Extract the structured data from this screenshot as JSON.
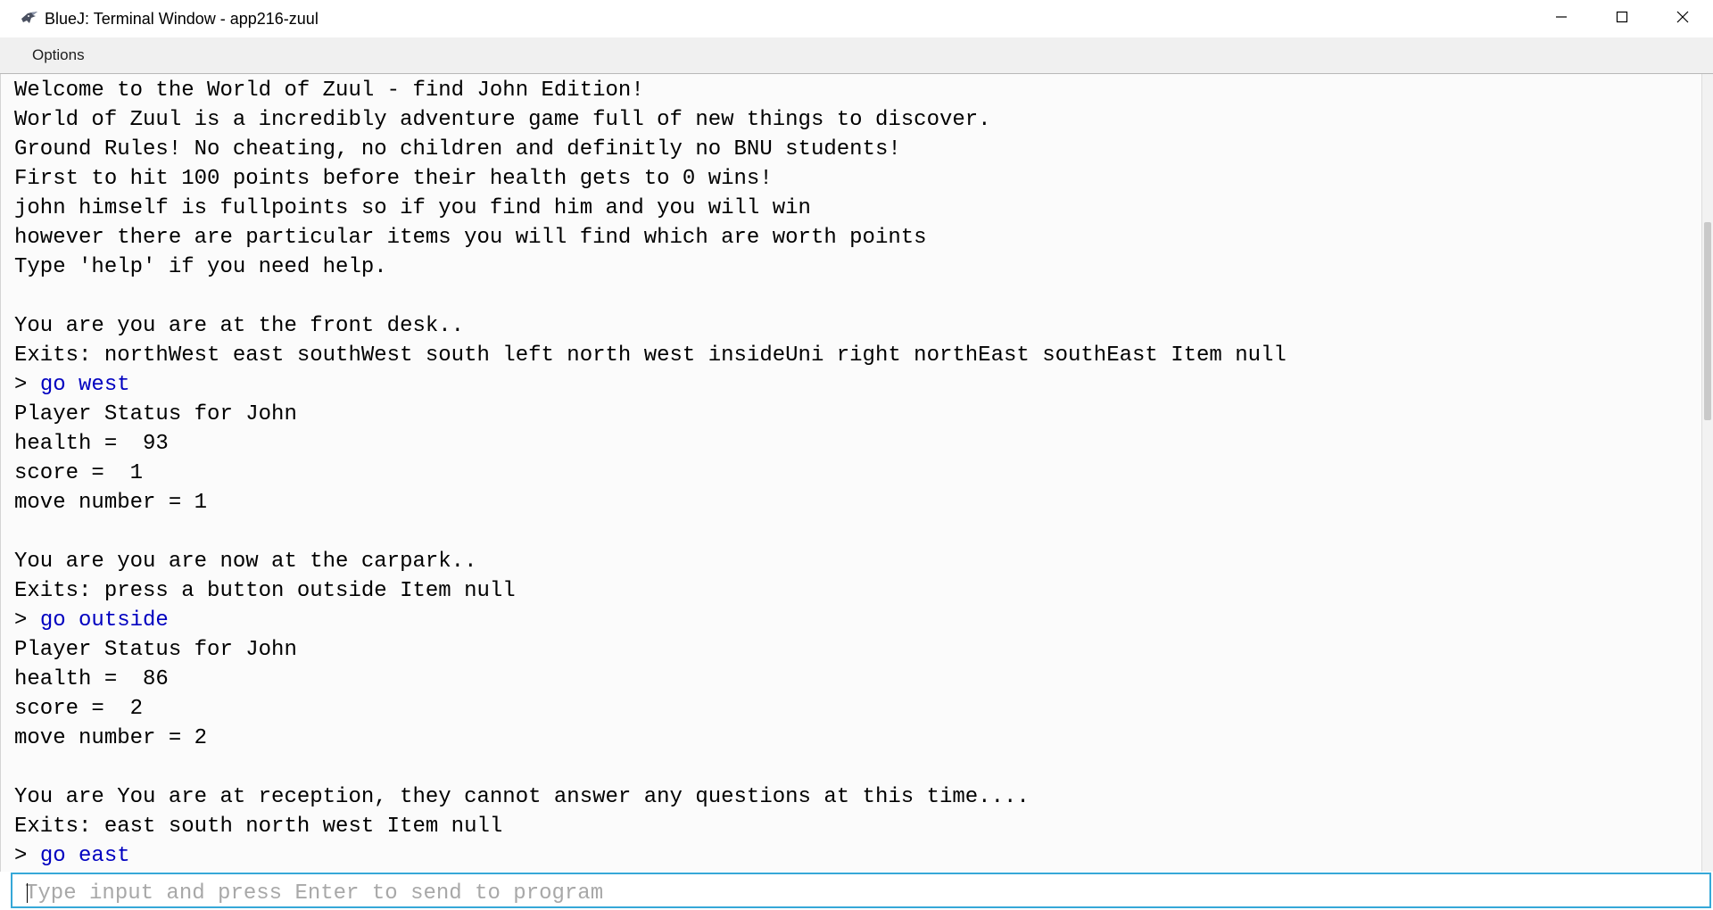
{
  "window": {
    "title": "BlueJ: Terminal Window - app216-zuul",
    "app_icon": "bluej-bird-icon",
    "controls": [
      "minimize-icon",
      "maximize-icon",
      "close-icon"
    ]
  },
  "menubar": {
    "items": [
      {
        "label": "Options"
      }
    ]
  },
  "terminal": {
    "lines": [
      {
        "type": "out",
        "text": "Welcome to the World of Zuul - find John Edition!"
      },
      {
        "type": "out",
        "text": "World of Zuul is a incredibly adventure game full of new things to discover."
      },
      {
        "type": "out",
        "text": "Ground Rules! No cheating, no children and definitly no BNU students!"
      },
      {
        "type": "out",
        "text": "First to hit 100 points before their health gets to 0 wins!"
      },
      {
        "type": "out",
        "text": "john himself is fullpoints so if you find him and you will win"
      },
      {
        "type": "out",
        "text": "however there are particular items you will find which are worth points"
      },
      {
        "type": "out",
        "text": "Type 'help' if you need help."
      },
      {
        "type": "out",
        "text": ""
      },
      {
        "type": "out",
        "text": "You are you are at the front desk.."
      },
      {
        "type": "out",
        "text": "Exits: northWest east southWest south left north west insideUni right northEast southEast Item null"
      },
      {
        "type": "cmd",
        "prompt": "> ",
        "text": "go west"
      },
      {
        "type": "out",
        "text": "Player Status for John"
      },
      {
        "type": "out",
        "text": "health =  93"
      },
      {
        "type": "out",
        "text": "score =  1"
      },
      {
        "type": "out",
        "text": "move number = 1"
      },
      {
        "type": "out",
        "text": ""
      },
      {
        "type": "out",
        "text": "You are you are now at the carpark.."
      },
      {
        "type": "out",
        "text": "Exits: press a button outside Item null"
      },
      {
        "type": "cmd",
        "prompt": "> ",
        "text": "go outside"
      },
      {
        "type": "out",
        "text": "Player Status for John"
      },
      {
        "type": "out",
        "text": "health =  86"
      },
      {
        "type": "out",
        "text": "score =  2"
      },
      {
        "type": "out",
        "text": "move number = 2"
      },
      {
        "type": "out",
        "text": ""
      },
      {
        "type": "out",
        "text": "You are You are at reception, they cannot answer any questions at this time...."
      },
      {
        "type": "out",
        "text": "Exits: east south north west Item null"
      },
      {
        "type": "cmd",
        "prompt": "> ",
        "text": "go east"
      }
    ]
  },
  "input": {
    "value": "",
    "placeholder": "Type input and press Enter to send to program"
  },
  "colors": {
    "command_text": "#0000c0",
    "input_border": "#36a8d8",
    "placeholder": "#a8a8a8"
  }
}
